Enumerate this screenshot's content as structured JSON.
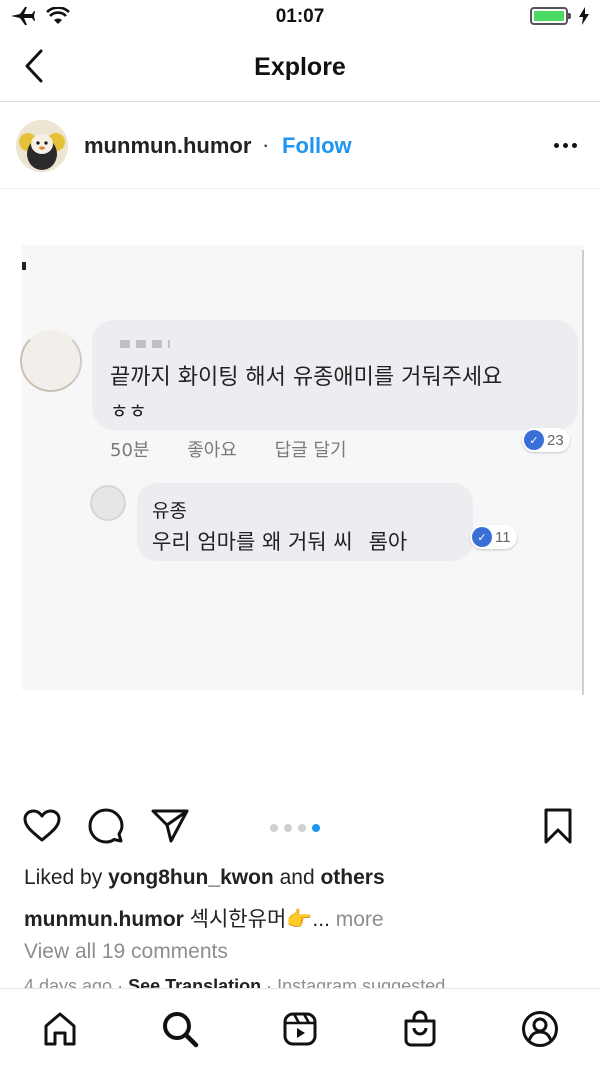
{
  "status_bar": {
    "time": "01:07",
    "battery_level": 1.0
  },
  "nav": {
    "title": "Explore"
  },
  "post": {
    "username": "munmun.humor",
    "separator": "·",
    "follow_label": "Follow",
    "media": {
      "comment1": {
        "text_line1": "끝까지 화이팅 해서 유종애미를 거둬주세요",
        "text_line2": "ㅎㅎ",
        "time": "50분",
        "like": "좋아요",
        "reply": "답글 달기",
        "likes_count": "23"
      },
      "comment2": {
        "author": "유종",
        "text_a": "우리 엄마를 왜 거둬 씨",
        "text_b": "롬아",
        "likes_count": "11"
      }
    },
    "pager": {
      "count": 4,
      "active_index": 3
    },
    "liked_by_prefix": "Liked by ",
    "liked_by_user": "yong8hun_kwon",
    "liked_by_and": " and ",
    "liked_by_others": "others",
    "caption_user": "munmun.humor",
    "caption_text": " 섹시한유머👉...",
    "caption_more": " more",
    "view_comments": "View all 19 comments",
    "meta_time": "4 days ago · ",
    "meta_translation": "See Translation",
    "meta_suggested": " · Instagram suggested"
  },
  "icons": {
    "back": "chevron-left-icon",
    "more": "more-horizontal-icon",
    "like": "heart-icon",
    "comment": "comment-icon",
    "share": "paper-plane-icon",
    "save": "bookmark-icon",
    "tabs": [
      "home-icon",
      "search-icon",
      "reels-icon",
      "shop-icon",
      "profile-icon"
    ]
  },
  "colors": {
    "accent": "#1e95f0",
    "battery": "#4cd964",
    "fb_like": "#3b6fd8"
  }
}
